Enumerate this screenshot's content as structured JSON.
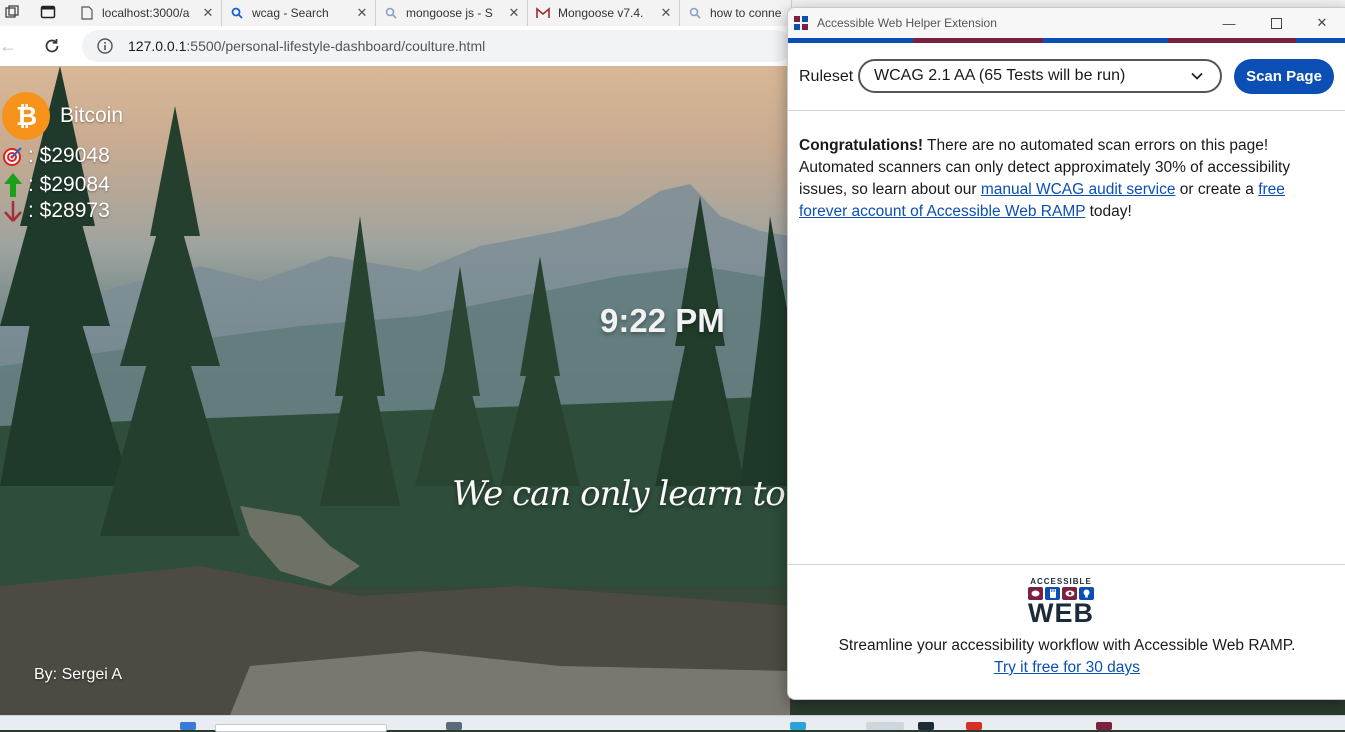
{
  "browser": {
    "tabs": [
      {
        "label": "localhost:3000/a",
        "icon": "page-icon"
      },
      {
        "label": "wcag - Search",
        "icon": "search-icon"
      },
      {
        "label": "mongoose js - S",
        "icon": "search-icon"
      },
      {
        "label": "Mongoose v7.4.",
        "icon": "mongoose-icon"
      },
      {
        "label": "how to conne",
        "icon": "search-icon"
      }
    ],
    "url_host": "127.0.0.1",
    "url_rest": ":5500/personal-lifestyle-dashboard/coulture.html"
  },
  "page": {
    "crypto_name": "Bitcoin",
    "current_price": ": $29048",
    "high_price": ": $29084",
    "low_price": ": $28973",
    "time": "9:22 PM",
    "quote": "We can only learn to love by",
    "author": "By: Sergei A"
  },
  "extension": {
    "title": "Accessible Web Helper Extension",
    "ruleset_label": "Ruleset",
    "ruleset_value": "WCAG 2.1 AA (65 Tests will be run)",
    "scan_button": "Scan Page",
    "message": {
      "bold": "Congratulations!",
      "text1": " There are no automated scan errors on this page! Automated scanners can only detect approximately 30% of accessibility issues, so learn about our ",
      "link1": "manual WCAG audit service",
      "text2": " or create a ",
      "link2": "free forever account of Accessible Web RAMP",
      "text3": " today!"
    },
    "logo_small": "ACCESSIBLE",
    "logo_big": "WEB",
    "promo": "Streamline your accessibility workflow with Accessible Web RAMP.",
    "try_link": "Try it free for 30 days",
    "colors": {
      "brand_blue": "#0b4fb5",
      "brand_maroon": "#7a2040",
      "brand_navy": "#1c2a3a"
    }
  }
}
